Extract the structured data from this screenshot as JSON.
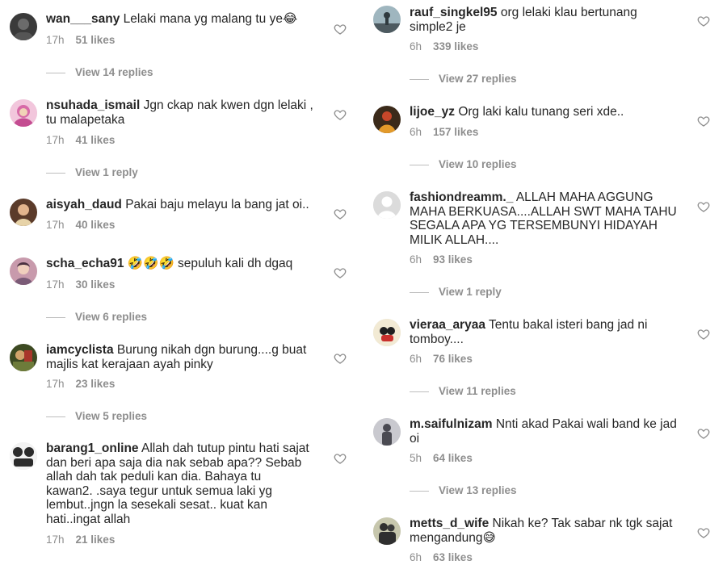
{
  "left": [
    {
      "username": "wan___sany",
      "text": "Lelaki mana yg malang tu ye😂",
      "time": "17h",
      "likes": "51 likes",
      "replies": "View 14 replies",
      "avatar_color": "#3a3a3a"
    },
    {
      "username": "nsuhada_ismail",
      "text": "Jgn ckap nak kwen dgn lelaki ,\ntu malapetaka",
      "time": "17h",
      "likes": "41 likes",
      "replies": "View 1 reply",
      "avatar_color": "#d76aa8"
    },
    {
      "username": "aisyah_daud",
      "text": "Pakai baju melayu la bang jat oi..",
      "time": "17h",
      "likes": "40 likes",
      "replies": "",
      "avatar_color": "#8a5a3c"
    },
    {
      "username": "scha_echa91",
      "text": "🤣🤣🤣 sepuluh kali dh dgaq",
      "time": "17h",
      "likes": "30 likes",
      "replies": "View 6 replies",
      "avatar_color": "#b7849c"
    },
    {
      "username": "iamcyclista",
      "text": "Burung nikah dgn burung....g buat\nmajlis kat kerajaan ayah pinky",
      "time": "17h",
      "likes": "23 likes",
      "replies": "View 5 replies",
      "avatar_color": "#4b5a2e"
    },
    {
      "username": "barang1_online",
      "text": "Allah dah tutup pintu hati sajat\ndan beri apa saja dia nak sebab apa?? Sebab\nallah dah tak peduli kan dia.  Bahaya tu\nkawan2. .saya tegur untuk semua laki yg\nlembut..jngn la sesekali sesat.. kuat kan\nhati..ingat allah",
      "time": "17h",
      "likes": "21 likes",
      "replies": "",
      "avatar_color": "#2b2b2b"
    }
  ],
  "right": [
    {
      "username": "rauf_singkel95",
      "text": "org lelaki klau bertunang\nsimple2 je",
      "time": "6h",
      "likes": "339 likes",
      "replies": "View 27 replies",
      "avatar_color": "#6f8b96"
    },
    {
      "username": "lijoe_yz",
      "text": "Org laki kalu tunang seri xde..",
      "time": "6h",
      "likes": "157 likes",
      "replies": "View 10 replies",
      "avatar_color": "#c7472a"
    },
    {
      "username": "fashiondreamm._",
      "text": "ALLAH MAHA AGGUNG\nMAHA BERKUASA....ALLAH SWT MAHA TAHU\nSEGALA APA YG TERSEMBUNYI  HIDAYAH\nMILIK ALLAH....",
      "time": "6h",
      "likes": "93 likes",
      "replies": "View 1 reply",
      "avatar_color": "#dbdbdb"
    },
    {
      "username": "vieraa_aryaa",
      "text": "Tentu bakal isteri bang jad ni\ntomboy....",
      "time": "6h",
      "likes": "76 likes",
      "replies": "View 11 replies",
      "avatar_color": "#e8d9b0"
    },
    {
      "username": "m.saifulnizam",
      "text": "Nnti akad Pakai wali band ke jad\noi",
      "time": "5h",
      "likes": "64 likes",
      "replies": "View 13 replies",
      "avatar_color": "#7e7e86"
    },
    {
      "username": "metts_d_wife",
      "text": "Nikah ke? Tak sabar nk tgk sajat\nmengandung😅",
      "time": "6h",
      "likes": "63 likes",
      "replies": "",
      "avatar_color": "#a7a78a"
    }
  ]
}
